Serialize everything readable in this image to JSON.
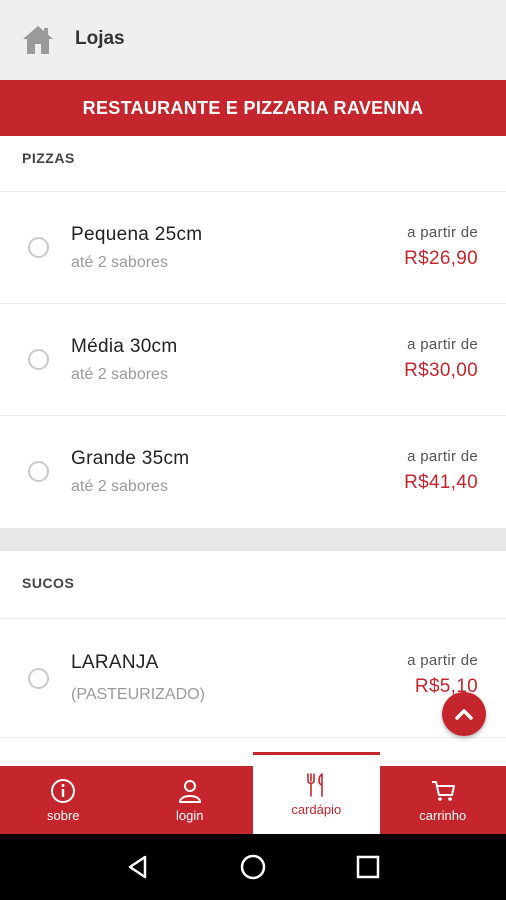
{
  "topbar": {
    "title": "Lojas",
    "icon": "home-icon"
  },
  "banner": {
    "title": "RESTAURANTE E PIZZARIA RAVENNA"
  },
  "sections": [
    {
      "header": "PIZZAS",
      "items": [
        {
          "name": "Pequena 25cm",
          "sub": "até 2 sabores",
          "from": "a partir de",
          "price": "R$26,90"
        },
        {
          "name": "Média 30cm",
          "sub": "até 2 sabores",
          "from": "a partir de",
          "price": "R$30,00"
        },
        {
          "name": "Grande 35cm",
          "sub": "até 2 sabores",
          "from": "a partir de",
          "price": "R$41,40"
        }
      ]
    },
    {
      "header": "SUCOS",
      "items": [
        {
          "name": "LARANJA",
          "sub": "(PASTEURIZADO)",
          "from": "a partir de",
          "price": "R$5,10"
        }
      ]
    }
  ],
  "bottom_nav": [
    {
      "label": "sobre",
      "icon": "info-icon"
    },
    {
      "label": "login",
      "icon": "user-icon"
    },
    {
      "label": "cardápio",
      "icon": "utensils-icon",
      "active": true
    },
    {
      "label": "carrinho",
      "icon": "cart-icon"
    }
  ],
  "colors": {
    "accent": "#c5262d",
    "topbar_bg": "#efefef"
  }
}
